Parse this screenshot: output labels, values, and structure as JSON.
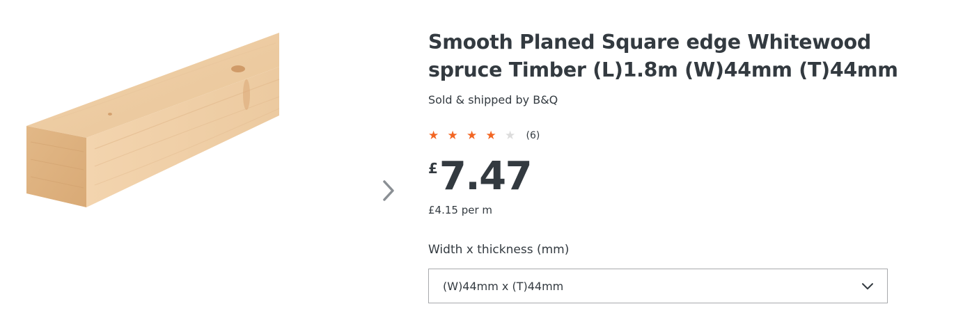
{
  "gallery": {
    "image_alt": "Smooth Planed Square edge Whitewood spruce Timber",
    "next_icon": "chevron-right-icon"
  },
  "product": {
    "title": "Smooth Planed Square edge Whitewood spruce Timber (L)1.8m (W)44mm (T)44mm",
    "seller": "Sold & shipped by B&Q",
    "rating": {
      "value": 4,
      "max": 5,
      "count_label": "(6)"
    },
    "price": {
      "currency": "£",
      "amount": "7.47"
    },
    "unit_price": "£4.15 per m"
  },
  "options": {
    "label": "Width x thickness (mm)",
    "selected": "(W)44mm x (T)44mm"
  },
  "colors": {
    "text": "#333a40",
    "star_active": "#f26522",
    "star_inactive": "#dcdcdc",
    "border": "#a7a9ac"
  }
}
